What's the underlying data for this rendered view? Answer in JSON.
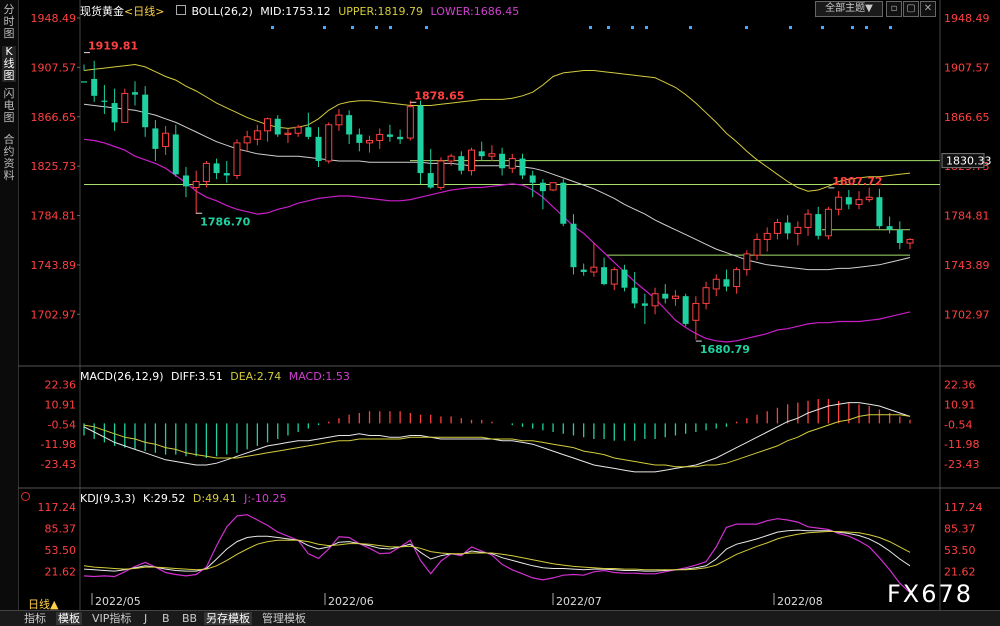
{
  "sidebar": {
    "tabs": [
      "分时图",
      "K线图",
      "闪电图",
      "合约资料"
    ]
  },
  "header": {
    "symbol": "现货黄金",
    "period": "<日线>",
    "boll_label": "BOLL(26,2)",
    "mid": "MID:1753.12",
    "upper": "UPPER:1819.79",
    "lower": "LOWER:1686.45",
    "theme_button": "全部主题",
    "theme_arrow": "▼"
  },
  "macd_header": {
    "name": "MACD(26,12,9)",
    "diff": "DIFF:3.51",
    "dea": "DEA:2.74",
    "macd": "MACD:1.53"
  },
  "kdj_header": {
    "name": "KDJ(9,3,3)",
    "k": "K:29.52",
    "d": "D:49.41",
    "j": "J:-10.25"
  },
  "bottom_tabs": [
    "指标",
    "模板",
    "VIP指标",
    "J",
    "B",
    "BB",
    "另存模板",
    "管理模板"
  ],
  "period_button": "日线▲",
  "watermark": "FX678",
  "colors": {
    "up": "#ff4040",
    "down": "#1fd1a0",
    "mid": "#d0d0d0",
    "upper": "#d4cc3c",
    "lower": "#c81ec8",
    "hline": "#a6e06a",
    "j": "#d030d0"
  },
  "chart_data": [
    {
      "type": "candlestick",
      "title": "现货黄金 <日线>",
      "ylim": [
        1680,
        1950
      ],
      "yticks": [
        "1948.49",
        "1907.57",
        "1866.65",
        "1825.73",
        "1784.81",
        "1743.89",
        "1702.97"
      ],
      "xticks": [
        "2022/05",
        "2022/06",
        "2022/07",
        "2022/08"
      ],
      "annotations": [
        "1919.81",
        "1878.65",
        "1786.70",
        "1680.79",
        "1807.72"
      ],
      "price_tag": "1830.33",
      "horizontal_lines": [
        1830.33,
        1810.5,
        1773,
        1752
      ],
      "candles": [
        [
          1896,
          1910,
          1905,
          1895
        ],
        [
          1898,
          1913,
          1879,
          1884
        ],
        [
          1880,
          1893,
          1869,
          1879
        ],
        [
          1878,
          1890,
          1855,
          1862
        ],
        [
          1862,
          1890,
          1862,
          1886
        ],
        [
          1887,
          1896,
          1876,
          1885
        ],
        [
          1885,
          1892,
          1850,
          1858
        ],
        [
          1857,
          1864,
          1830,
          1840
        ],
        [
          1842,
          1859,
          1835,
          1853
        ],
        [
          1852,
          1860,
          1817,
          1819
        ],
        [
          1818,
          1825,
          1800,
          1809
        ],
        [
          1808,
          1822,
          1786,
          1813
        ],
        [
          1813,
          1830,
          1808,
          1828
        ],
        [
          1828,
          1832,
          1815,
          1820
        ],
        [
          1820,
          1830,
          1812,
          1818
        ],
        [
          1818,
          1848,
          1815,
          1845
        ],
        [
          1845,
          1855,
          1838,
          1850
        ],
        [
          1848,
          1860,
          1843,
          1855
        ],
        [
          1855,
          1866,
          1846,
          1865
        ],
        [
          1865,
          1868,
          1850,
          1852
        ],
        [
          1852,
          1857,
          1845,
          1853
        ],
        [
          1853,
          1860,
          1850,
          1858
        ],
        [
          1858,
          1870,
          1848,
          1850
        ],
        [
          1850,
          1858,
          1825,
          1830
        ],
        [
          1830,
          1862,
          1828,
          1860
        ],
        [
          1860,
          1873,
          1855,
          1868
        ],
        [
          1868,
          1872,
          1844,
          1852
        ],
        [
          1852,
          1857,
          1838,
          1845
        ],
        [
          1845,
          1851,
          1837,
          1847
        ],
        [
          1847,
          1857,
          1840,
          1852
        ],
        [
          1852,
          1860,
          1846,
          1850
        ],
        [
          1850,
          1856,
          1844,
          1848
        ],
        [
          1849,
          1880,
          1847,
          1875
        ],
        [
          1876,
          1880,
          1811,
          1820
        ],
        [
          1820,
          1840,
          1807,
          1808
        ],
        [
          1808,
          1833,
          1806,
          1830
        ],
        [
          1830,
          1836,
          1826,
          1834
        ],
        [
          1834,
          1838,
          1819,
          1822
        ],
        [
          1822,
          1841,
          1818,
          1839
        ],
        [
          1838,
          1846,
          1830,
          1834
        ],
        [
          1834,
          1843,
          1830,
          1836
        ],
        [
          1836,
          1841,
          1818,
          1824
        ],
        [
          1824,
          1836,
          1820,
          1832
        ],
        [
          1832,
          1836,
          1815,
          1818
        ],
        [
          1818,
          1822,
          1800,
          1812
        ],
        [
          1812,
          1815,
          1790,
          1805
        ],
        [
          1806,
          1812,
          1805,
          1812
        ],
        [
          1812,
          1815,
          1776,
          1778
        ],
        [
          1778,
          1786,
          1736,
          1742
        ],
        [
          1740,
          1745,
          1735,
          1738
        ],
        [
          1738,
          1762,
          1734,
          1742
        ],
        [
          1742,
          1750,
          1727,
          1728
        ],
        [
          1728,
          1742,
          1723,
          1740
        ],
        [
          1740,
          1744,
          1722,
          1725
        ],
        [
          1725,
          1738,
          1708,
          1712
        ],
        [
          1712,
          1720,
          1695,
          1710
        ],
        [
          1710,
          1725,
          1703,
          1720
        ],
        [
          1720,
          1728,
          1712,
          1716
        ],
        [
          1716,
          1723,
          1710,
          1718
        ],
        [
          1718,
          1720,
          1693,
          1695
        ],
        [
          1698,
          1718,
          1682,
          1712
        ],
        [
          1712,
          1730,
          1707,
          1725
        ],
        [
          1724,
          1736,
          1718,
          1732
        ],
        [
          1732,
          1740,
          1722,
          1726
        ],
        [
          1726,
          1742,
          1720,
          1740
        ],
        [
          1740,
          1756,
          1735,
          1753
        ],
        [
          1752,
          1770,
          1748,
          1765
        ],
        [
          1765,
          1775,
          1755,
          1770
        ],
        [
          1770,
          1782,
          1765,
          1779
        ],
        [
          1779,
          1785,
          1765,
          1770
        ],
        [
          1770,
          1780,
          1760,
          1775
        ],
        [
          1775,
          1790,
          1768,
          1786
        ],
        [
          1786,
          1792,
          1765,
          1768
        ],
        [
          1768,
          1792,
          1765,
          1790
        ],
        [
          1790,
          1805,
          1785,
          1800
        ],
        [
          1800,
          1806,
          1790,
          1794
        ],
        [
          1794,
          1805,
          1790,
          1798
        ],
        [
          1798,
          1808,
          1796,
          1800
        ],
        [
          1800,
          1807,
          1774,
          1776
        ],
        [
          1776,
          1784,
          1770,
          1773
        ],
        [
          1773,
          1780,
          1757,
          1762
        ],
        [
          1762,
          1766,
          1757,
          1765
        ]
      ],
      "upper": [
        1905,
        1906,
        1907,
        1908,
        1909,
        1910,
        1908,
        1904,
        1900,
        1897,
        1892,
        1888,
        1883,
        1878,
        1874,
        1870,
        1866,
        1863,
        1860,
        1858,
        1857,
        1858,
        1860,
        1865,
        1872,
        1877,
        1879,
        1880,
        1880,
        1879,
        1878,
        1877,
        1876,
        1876,
        1876,
        1877,
        1878,
        1879,
        1880,
        1881,
        1881,
        1881,
        1882,
        1884,
        1887,
        1893,
        1900,
        1903,
        1904,
        1905,
        1905,
        1904,
        1903,
        1902,
        1901,
        1900,
        1899,
        1895,
        1891,
        1885,
        1878,
        1870,
        1862,
        1853,
        1846,
        1838,
        1831,
        1825,
        1819,
        1813,
        1808,
        1805,
        1806,
        1809,
        1813,
        1815,
        1816,
        1817,
        1817,
        1818,
        1819,
        1820
      ],
      "mid": [
        1877,
        1876,
        1875,
        1874,
        1873,
        1872,
        1870,
        1868,
        1865,
        1862,
        1858,
        1854,
        1850,
        1846,
        1843,
        1840,
        1838,
        1836,
        1835,
        1834,
        1834,
        1834,
        1833,
        1832,
        1831,
        1830,
        1830,
        1830,
        1829,
        1829,
        1829,
        1829,
        1829,
        1829,
        1828,
        1828,
        1828,
        1827,
        1826,
        1826,
        1826,
        1826,
        1826,
        1825,
        1824,
        1822,
        1819,
        1816,
        1813,
        1810,
        1807,
        1803,
        1799,
        1794,
        1790,
        1786,
        1781,
        1777,
        1773,
        1769,
        1765,
        1761,
        1757,
        1754,
        1751,
        1748,
        1746,
        1744,
        1743,
        1742,
        1741,
        1740,
        1740,
        1740,
        1741,
        1741,
        1742,
        1743,
        1744,
        1746,
        1748,
        1750
      ],
      "lower": [
        1848,
        1847,
        1845,
        1842,
        1839,
        1834,
        1831,
        1828,
        1824,
        1818,
        1812,
        1805,
        1800,
        1797,
        1793,
        1790,
        1788,
        1786,
        1787,
        1790,
        1792,
        1795,
        1797,
        1799,
        1800,
        1801,
        1801,
        1800,
        1799,
        1798,
        1797,
        1797,
        1798,
        1800,
        1802,
        1804,
        1806,
        1807,
        1808,
        1808,
        1809,
        1810,
        1811,
        1810,
        1806,
        1800,
        1792,
        1784,
        1776,
        1770,
        1762,
        1754,
        1746,
        1738,
        1730,
        1723,
        1716,
        1707,
        1698,
        1692,
        1687,
        1683,
        1681,
        1680,
        1681,
        1683,
        1685,
        1687,
        1690,
        1691,
        1693,
        1695,
        1696,
        1696,
        1697,
        1697,
        1697,
        1698,
        1699,
        1701,
        1703,
        1705
      ]
    },
    {
      "type": "macd",
      "title": "MACD(26,12,9)",
      "ylim": [
        -30,
        26
      ],
      "yticks": [
        "22.36",
        "10.91",
        "-0.54",
        "-11.98",
        "-23.43"
      ],
      "hist": [
        -7,
        -9,
        -11,
        -13,
        -14,
        -15,
        -16,
        -17,
        -18,
        -18,
        -19,
        -19,
        -20,
        -19,
        -18,
        -17,
        -15,
        -13,
        -11,
        -9,
        -7,
        -5,
        -3,
        -1,
        1,
        3,
        5,
        6,
        7,
        7,
        7,
        7,
        6,
        5,
        5,
        4,
        4,
        3,
        2,
        2,
        1,
        0,
        -1,
        -2,
        -3,
        -4,
        -5,
        -6,
        -7,
        -8,
        -9,
        -9,
        -10,
        -10,
        -10,
        -9,
        -9,
        -8,
        -7,
        -6,
        -5,
        -4,
        -3,
        -2,
        1,
        3,
        5,
        7,
        9,
        11,
        12,
        13,
        14,
        14,
        13,
        12,
        11,
        10,
        8,
        6,
        4,
        2
      ],
      "diff": [
        -2,
        -5,
        -8,
        -11,
        -13,
        -15,
        -17,
        -19,
        -21,
        -22,
        -23,
        -24,
        -24,
        -23,
        -21,
        -19,
        -17,
        -15,
        -13,
        -12,
        -11,
        -10,
        -10,
        -9,
        -8,
        -7,
        -7,
        -6,
        -7,
        -7,
        -8,
        -8,
        -7,
        -7,
        -8,
        -9,
        -9,
        -9,
        -9,
        -9,
        -9,
        -10,
        -10,
        -11,
        -12,
        -14,
        -16,
        -18,
        -20,
        -22,
        -24,
        -25,
        -26,
        -27,
        -28,
        -28,
        -28,
        -27,
        -26,
        -25,
        -24,
        -22,
        -20,
        -17,
        -14,
        -11,
        -8,
        -5,
        -2,
        1,
        3,
        6,
        8,
        10,
        11,
        12,
        12,
        11,
        10,
        8,
        6,
        4
      ],
      "dea": [
        -1,
        -2,
        -4,
        -6,
        -8,
        -9,
        -11,
        -12,
        -14,
        -15,
        -17,
        -18,
        -19,
        -20,
        -20,
        -20,
        -19,
        -18,
        -17,
        -16,
        -15,
        -14,
        -13,
        -12,
        -11,
        -10,
        -10,
        -9,
        -9,
        -9,
        -9,
        -9,
        -8,
        -8,
        -8,
        -8,
        -8,
        -8,
        -8,
        -8,
        -9,
        -9,
        -9,
        -10,
        -10,
        -11,
        -12,
        -13,
        -14,
        -16,
        -17,
        -18,
        -20,
        -21,
        -22,
        -23,
        -24,
        -24,
        -25,
        -25,
        -25,
        -24,
        -24,
        -23,
        -21,
        -19,
        -17,
        -15,
        -13,
        -10,
        -8,
        -5,
        -3,
        -1,
        1,
        2,
        4,
        5,
        5,
        5,
        5,
        4
      ]
    },
    {
      "type": "kdj",
      "title": "KDJ(9,3,3)",
      "ylim": [
        0,
        125
      ],
      "yticks": [
        "117.24",
        "85.37",
        "53.50",
        "21.62"
      ],
      "k": [
        25,
        24,
        23,
        22,
        24,
        27,
        30,
        28,
        25,
        23,
        22,
        22,
        26,
        40,
        55,
        66,
        72,
        74,
        74,
        72,
        70,
        68,
        60,
        55,
        58,
        65,
        66,
        63,
        60,
        56,
        55,
        58,
        62,
        50,
        40,
        45,
        48,
        47,
        52,
        50,
        48,
        42,
        38,
        34,
        30,
        27,
        26,
        26,
        25,
        24,
        25,
        25,
        24,
        23,
        23,
        22,
        22,
        23,
        24,
        25,
        27,
        30,
        40,
        55,
        62,
        66,
        70,
        75,
        80,
        82,
        83,
        82,
        82,
        82,
        80,
        78,
        75,
        70,
        62,
        52,
        40,
        30
      ],
      "d": [
        30,
        28,
        27,
        26,
        25,
        26,
        28,
        28,
        27,
        26,
        25,
        24,
        25,
        30,
        38,
        47,
        55,
        62,
        66,
        68,
        68,
        68,
        66,
        62,
        60,
        61,
        63,
        63,
        62,
        60,
        58,
        58,
        59,
        56,
        51,
        49,
        48,
        48,
        49,
        49,
        49,
        47,
        45,
        42,
        39,
        36,
        33,
        31,
        29,
        28,
        27,
        26,
        26,
        25,
        25,
        24,
        24,
        24,
        24,
        24,
        25,
        27,
        31,
        39,
        47,
        53,
        59,
        64,
        70,
        74,
        77,
        79,
        80,
        81,
        81,
        80,
        79,
        76,
        72,
        66,
        58,
        50
      ],
      "j": [
        15,
        14,
        15,
        14,
        21,
        29,
        35,
        28,
        20,
        17,
        15,
        17,
        28,
        60,
        88,
        104,
        106,
        98,
        90,
        80,
        74,
        68,
        48,
        41,
        55,
        73,
        72,
        63,
        56,
        48,
        49,
        58,
        68,
        38,
        18,
        37,
        48,
        45,
        58,
        52,
        46,
        32,
        24,
        18,
        12,
        9,
        12,
        16,
        17,
        16,
        21,
        23,
        20,
        19,
        19,
        18,
        18,
        21,
        24,
        27,
        31,
        36,
        58,
        87,
        92,
        92,
        92,
        97,
        100,
        98,
        95,
        88,
        86,
        84,
        78,
        74,
        67,
        58,
        42,
        24,
        4,
        -10
      ]
    }
  ]
}
